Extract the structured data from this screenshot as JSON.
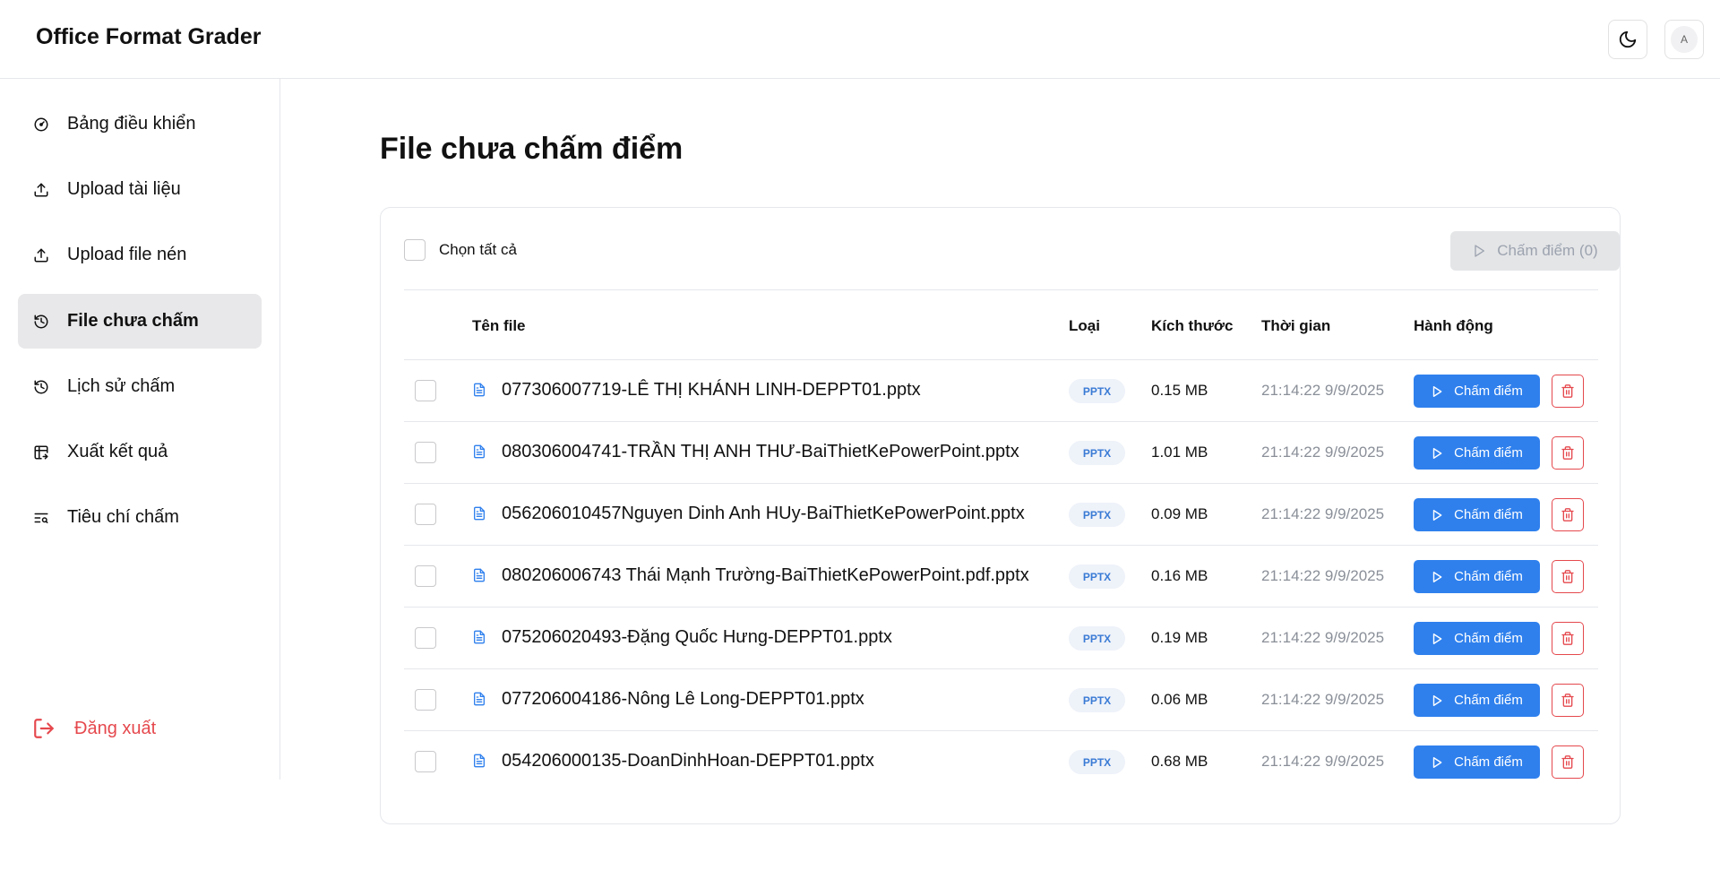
{
  "app": {
    "title": "Office Format Grader"
  },
  "header": {
    "avatar_initial": "A",
    "theme_icon": "moon-icon"
  },
  "sidebar": {
    "items": [
      {
        "label": "Bảng điều khiển",
        "icon": "gauge-icon",
        "active": false
      },
      {
        "label": "Upload tài liệu",
        "icon": "upload-icon",
        "active": false
      },
      {
        "label": "Upload file nén",
        "icon": "upload-icon",
        "active": false
      },
      {
        "label": "File chưa chấm",
        "icon": "history-icon",
        "active": true
      },
      {
        "label": "Lịch sử chấm",
        "icon": "history-icon",
        "active": false
      },
      {
        "label": "Xuất kết quả",
        "icon": "table-export-icon",
        "active": false
      },
      {
        "label": "Tiêu chí chấm",
        "icon": "text-search-icon",
        "active": false
      }
    ],
    "logout_label": "Đăng xuất"
  },
  "main": {
    "title": "File chưa chấm điểm",
    "select_all_label": "Chọn tất cả",
    "grade_selected_label": "Chấm điểm (0)",
    "columns": [
      "Tên file",
      "Loại",
      "Kích thước",
      "Thời gian",
      "Hành động"
    ],
    "grade_button_label": "Chấm điểm",
    "files": [
      {
        "name": "077306007719-LÊ THỊ KHÁNH LINH-DEPPT01.pptx",
        "type": "PPTX",
        "size": "0.15 MB",
        "time": "21:14:22 9/9/2025"
      },
      {
        "name": "080306004741-TRẦN THỊ ANH THƯ-BaiThietKePowerPoint.pptx",
        "type": "PPTX",
        "size": "1.01 MB",
        "time": "21:14:22 9/9/2025"
      },
      {
        "name": "056206010457Nguyen Dinh Anh HUy-BaiThietKePowerPoint.pptx",
        "type": "PPTX",
        "size": "0.09 MB",
        "time": "21:14:22 9/9/2025"
      },
      {
        "name": "080206006743 Thái Mạnh Trường-BaiThietKePowerPoint.pdf.pptx",
        "type": "PPTX",
        "size": "0.16 MB",
        "time": "21:14:22 9/9/2025"
      },
      {
        "name": "075206020493-Đặng Quốc Hưng-DEPPT01.pptx",
        "type": "PPTX",
        "size": "0.19 MB",
        "time": "21:14:22 9/9/2025"
      },
      {
        "name": "077206004186-Nông Lê Long-DEPPT01.pptx",
        "type": "PPTX",
        "size": "0.06 MB",
        "time": "21:14:22 9/9/2025"
      },
      {
        "name": "054206000135-DoanDinhHoan-DEPPT01.pptx",
        "type": "PPTX",
        "size": "0.68 MB",
        "time": "21:14:22 9/9/2025"
      }
    ]
  },
  "colors": {
    "primary": "#2f80ed",
    "danger": "#e5484d",
    "active_nav_bg": "#e8e8ea",
    "badge_bg": "#eef2f9",
    "muted_text": "#8a8f98"
  }
}
